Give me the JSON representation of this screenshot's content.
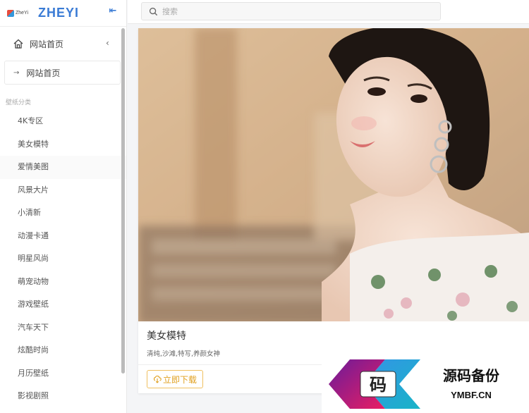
{
  "brand": {
    "logo_small": "ZheYi",
    "name": "ZHEYI"
  },
  "search": {
    "placeholder": "搜索"
  },
  "sidebar": {
    "home_label": "网站首页",
    "submenu_label": "网站首页",
    "section_title": "壁纸分类",
    "categories": [
      "4K专区",
      "美女模特",
      "爱情美图",
      "风景大片",
      "小清新",
      "动漫卡通",
      "明星风尚",
      "萌宠动物",
      "游戏壁纸",
      "汽车天下",
      "炫酷时尚",
      "月历壁纸",
      "影视剧照"
    ]
  },
  "card": {
    "title": "美女模特",
    "tags": "清纯,沙滩,特写,养颜女神",
    "download_label": "立即下载"
  },
  "watermark": {
    "big_char": "码",
    "title": "源码备份",
    "domain": "YMBF.CN"
  },
  "colors": {
    "brand": "#3a7bd5",
    "download": "#e0a020"
  }
}
